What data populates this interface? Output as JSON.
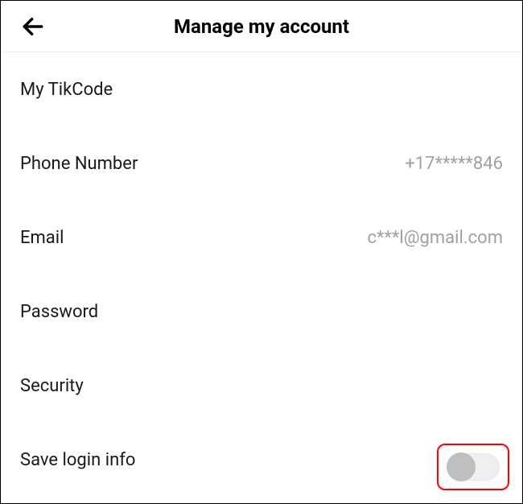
{
  "header": {
    "title": "Manage my account"
  },
  "rows": {
    "tikcode": {
      "label": "My TikCode",
      "value": ""
    },
    "phone": {
      "label": "Phone Number",
      "value": "+17*****846"
    },
    "email": {
      "label": "Email",
      "value": "c***l@gmail.com"
    },
    "password": {
      "label": "Password",
      "value": ""
    },
    "security": {
      "label": "Security",
      "value": ""
    },
    "savelogin": {
      "label": "Save login info",
      "toggle": false
    }
  }
}
